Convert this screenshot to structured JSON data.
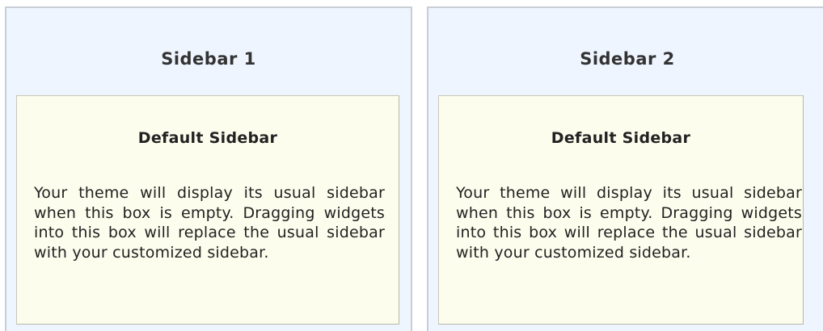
{
  "sidebars": [
    {
      "title": "Sidebar 1",
      "box_title": "Default Sidebar",
      "box_text": "Your theme will display its usual sidebar when this box is empty. Dragging widgets into this box will replace the usual sidebar with your customized sidebar."
    },
    {
      "title": "Sidebar 2",
      "box_title": "Default Sidebar",
      "box_text": "Your theme will display its usual sidebar when this box is empty. Dragging widgets into this box will replace the usual sidebar with your customized sidebar."
    }
  ],
  "colors": {
    "panel_bg": "#eef5fe",
    "panel_border": "#c9ced6",
    "drop_box_bg": "#fdfdee",
    "text": "#222222"
  }
}
